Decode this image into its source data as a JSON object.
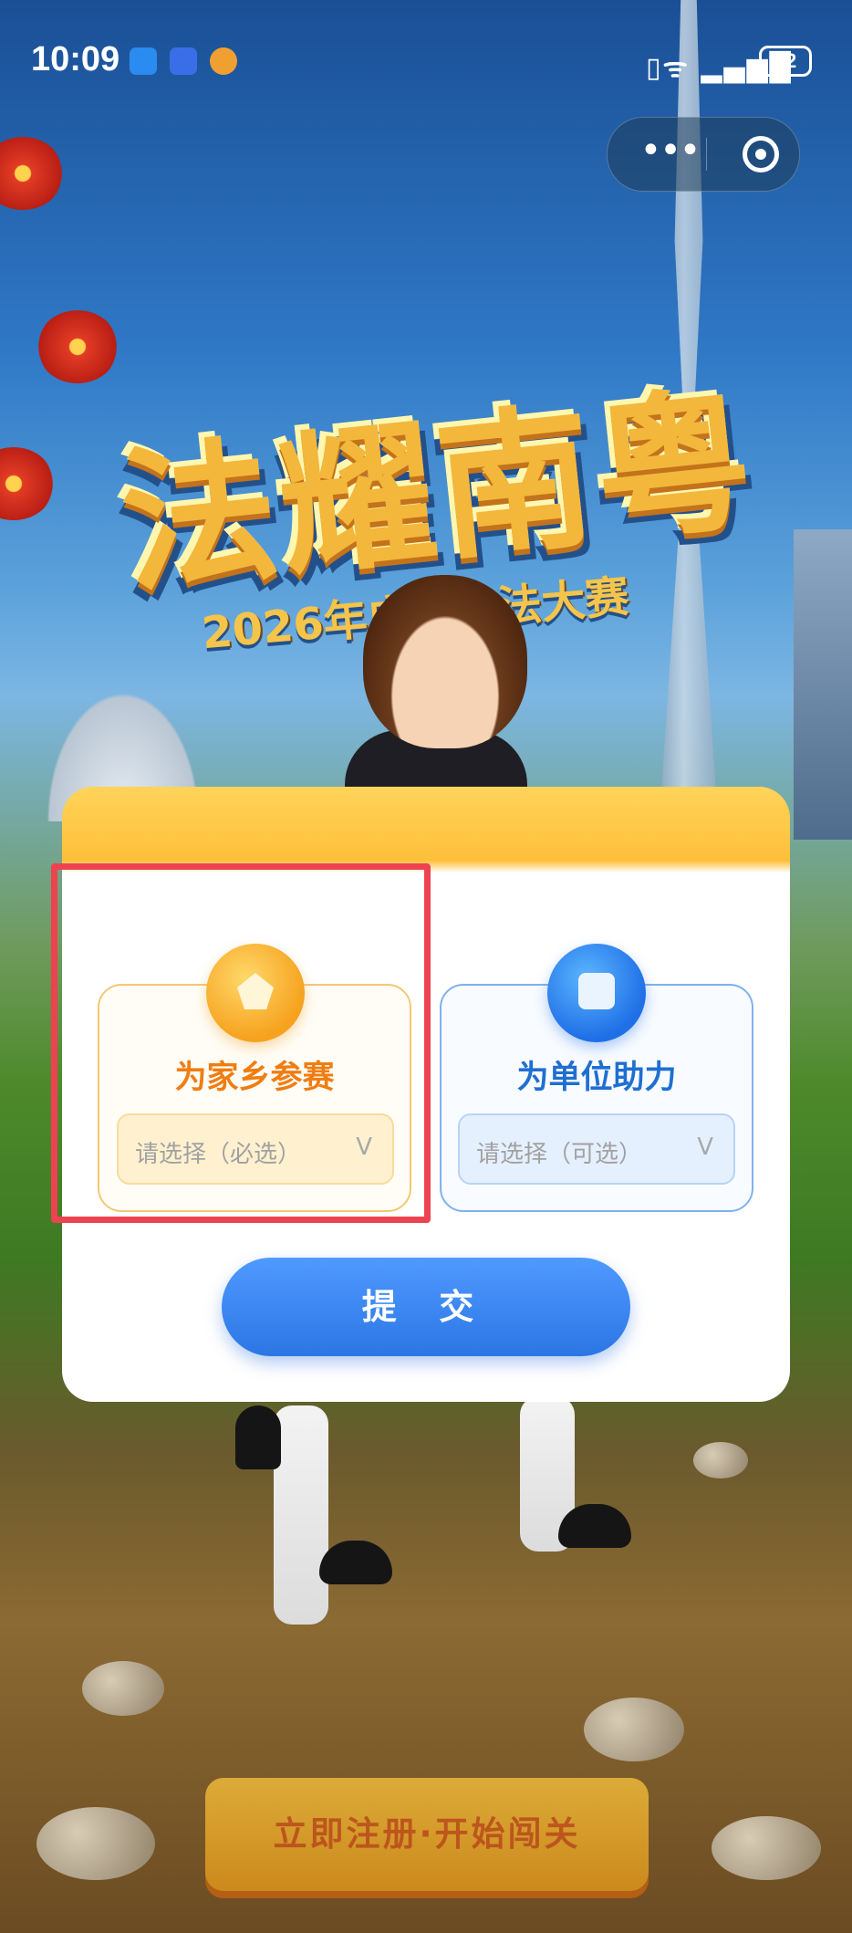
{
  "status_bar": {
    "time": "10:09",
    "battery": "72",
    "icons": [
      "chat-bubble-icon",
      "app-badge-icon",
      "sun-app-icon",
      "vibrate-icon",
      "wifi-icon",
      "signal-icon",
      "battery-icon"
    ]
  },
  "mini_program_capsule": {
    "more_label": "•••",
    "icons": [
      "more-icon",
      "close-target-icon"
    ]
  },
  "banner": {
    "title": "法耀南粤",
    "subtitle": "2026年广东普法大赛"
  },
  "form": {
    "options": [
      {
        "title": "为家乡参赛",
        "select_placeholder": "请选择（必选）",
        "arrow": "V",
        "icon": "location-map-icon",
        "color": "#f07d12"
      },
      {
        "title": "为单位助力",
        "select_placeholder": "请选择（可选）",
        "arrow": "V",
        "icon": "building-icon",
        "color": "#1f6fd1"
      }
    ],
    "submit_label": "提 交"
  },
  "footer": {
    "register_label": "立即注册·开始闯关"
  },
  "colors": {
    "accent_orange": "#f07d12",
    "accent_blue": "#2b76e4",
    "highlight_red": "#ee4250"
  }
}
